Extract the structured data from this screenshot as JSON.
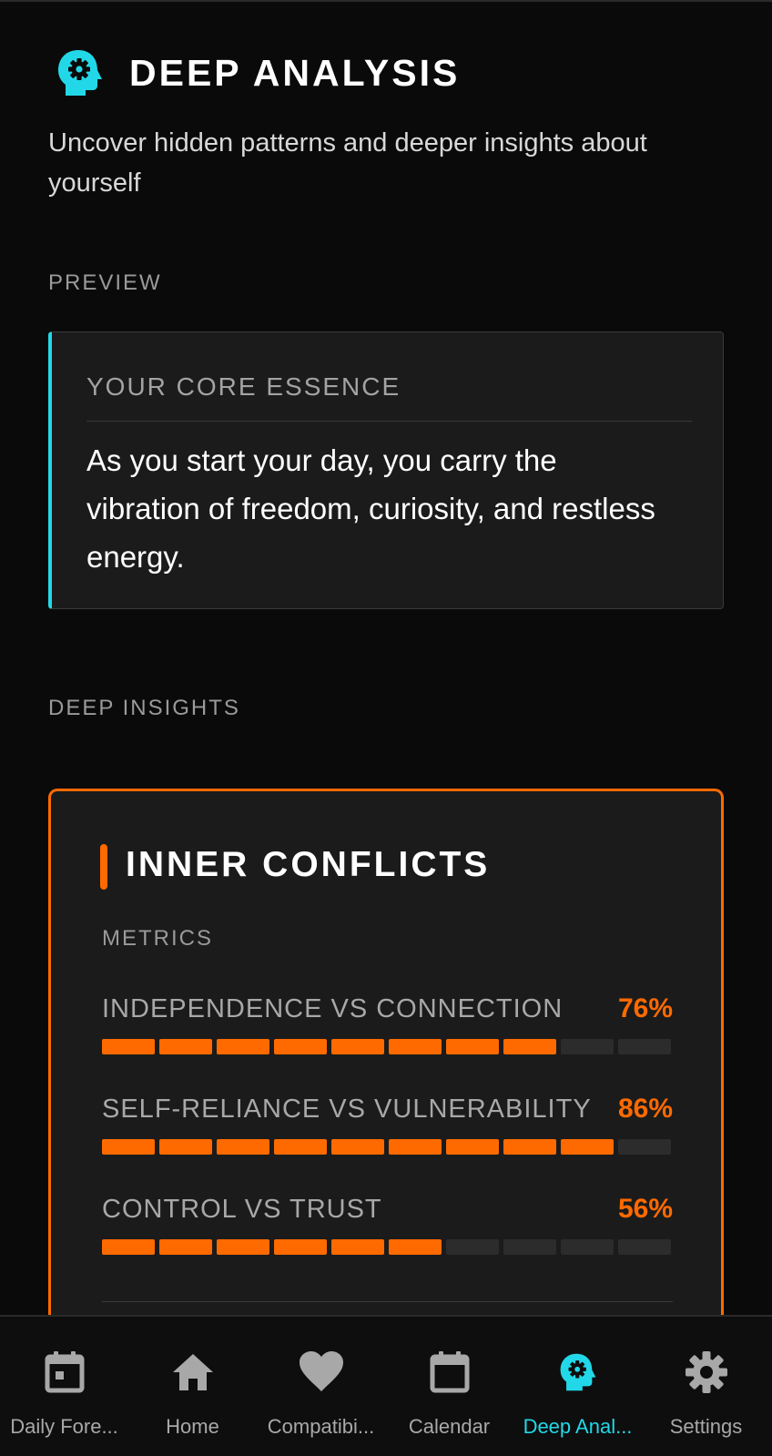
{
  "header": {
    "title": "DEEP ANALYSIS",
    "subtitle": "Uncover hidden patterns and deeper insights about yourself",
    "icon": "head-gear-icon"
  },
  "preview": {
    "section_label": "PREVIEW",
    "card_label": "YOUR CORE ESSENCE",
    "text": "As you start your day, you carry the vibration of freedom, curiosity, and restless energy."
  },
  "insights": {
    "section_label": "DEEP INSIGHTS",
    "card": {
      "title": "INNER CONFLICTS",
      "metrics_label": "METRICS",
      "metrics": [
        {
          "label": "INDEPENDENCE VS CONNECTION",
          "value": "76%",
          "filled_segments": 8,
          "total_segments": 10
        },
        {
          "label": "SELF-RELIANCE VS VULNERABILITY",
          "value": "86%",
          "filled_segments": 9,
          "total_segments": 10
        },
        {
          "label": "CONTROL VS TRUST",
          "value": "56%",
          "filled_segments": 6,
          "total_segments": 10
        }
      ]
    }
  },
  "nav": {
    "items": [
      {
        "label": "Daily Fore...",
        "icon": "calendar-day-icon",
        "active": false
      },
      {
        "label": "Home",
        "icon": "home-icon",
        "active": false
      },
      {
        "label": "Compatibi...",
        "icon": "heart-icon",
        "active": false
      },
      {
        "label": "Calendar",
        "icon": "calendar-icon",
        "active": false
      },
      {
        "label": "Deep Anal...",
        "icon": "head-gear-icon",
        "active": true
      },
      {
        "label": "Settings",
        "icon": "gear-icon",
        "active": false
      }
    ]
  },
  "colors": {
    "accent_cyan": "#22d8e8",
    "accent_orange": "#ff6a00",
    "background": "#0a0a0a",
    "card": "#1b1b1b"
  }
}
